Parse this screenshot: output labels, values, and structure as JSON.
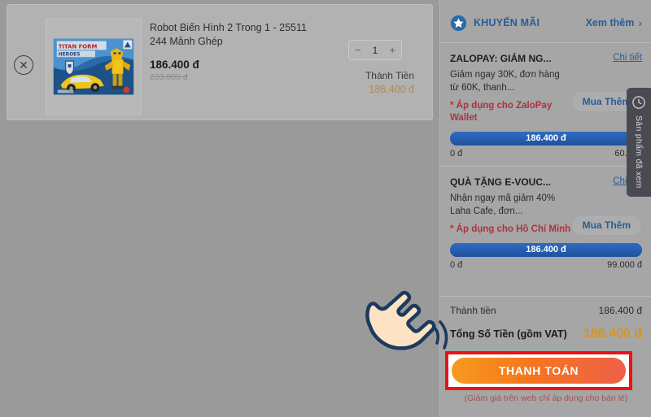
{
  "cart": {
    "remove_icon": "close-circle-icon",
    "product": {
      "title": "Robot Biến Hình 2 Trong 1 - 25511 244 Mảnh Ghép",
      "price": "186.400 đ",
      "old_price": "233.000 đ",
      "image_alt": "Robot Biến Hình 2 Trong 1 toy box",
      "quantity": "1",
      "decrease_label": "−",
      "increase_label": "+",
      "line_total_label": "Thành Tiền",
      "line_total_value": "186.400 đ"
    }
  },
  "summary": {
    "promo_header": {
      "icon": "star-circle-icon",
      "title": "KHUYẾN MÃI",
      "see_more": "Xem thêm",
      "chevron": "›"
    },
    "promotions": [
      {
        "name": "ZALOPAY: GIẢM NG...",
        "detail_link": "Chi tiết",
        "description": "Giảm ngay 30K, đơn hàng từ 60K, thanh...",
        "note": "* Áp dụng cho ZaloPay Wallet",
        "buy_more": "Mua Thêm",
        "progress_label": "186.400 đ",
        "progress_percent": 100,
        "scale_min": "0 đ",
        "scale_max": "60.000"
      },
      {
        "name": "QUÀ TẶNG E-VOUC...",
        "detail_link": "Chi tiết",
        "description": "Nhận ngay mã giảm 40% Laha Cafe, đơn...",
        "note": "* Áp dụng cho Hồ Chí Minh",
        "buy_more": "Mua Thêm",
        "progress_label": "186.400 đ",
        "progress_percent": 100,
        "scale_min": "0 đ",
        "scale_max": "99.000 đ"
      }
    ],
    "totals": {
      "subtotal_label": "Thành tiền",
      "subtotal_value": "186.400 đ",
      "grand_label": "Tổng Số Tiền (gồm VAT)",
      "grand_value": "186.400 đ"
    },
    "pay_button": "THANH TOÁN",
    "pay_note": "(Giảm giá trên web chỉ áp dụng cho bán lẻ)"
  },
  "viewed_tab": {
    "icon": "clock-icon",
    "label": "Sản phẩm đã xem"
  },
  "cursor": {
    "icon": "pointing-hand-cursor"
  },
  "colors": {
    "brand_blue": "#2a5c96",
    "progress_blue": "#1e5aa8",
    "accent_orange": "#d8941f",
    "pay_gradient_start": "#f79a1e",
    "pay_gradient_end": "#ef5f4a",
    "highlight_red": "#ee1111",
    "note_red": "#b03040"
  }
}
